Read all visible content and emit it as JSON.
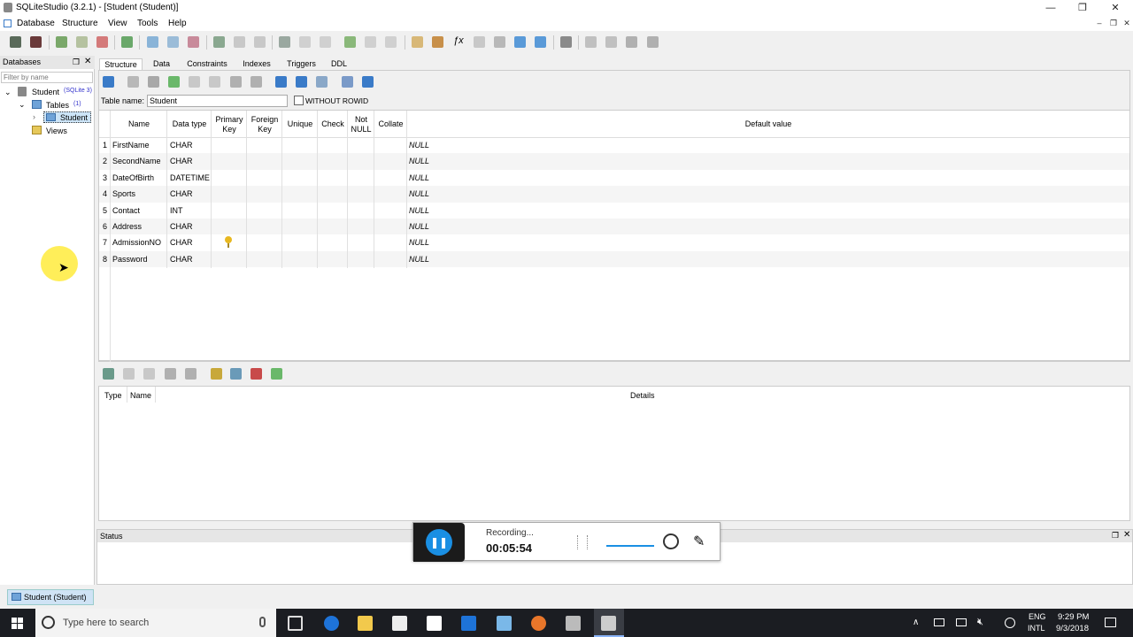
{
  "window": {
    "title": "SQLiteStudio (3.2.1) - [Student (Student)]",
    "controls": {
      "minimize": "—",
      "maximize": "❐",
      "close": "✕"
    }
  },
  "menu": {
    "items": [
      "Database",
      "Structure",
      "View",
      "Tools",
      "Help"
    ],
    "mdi_controls": {
      "minimize": "–",
      "restore": "❐",
      "close": "✕"
    }
  },
  "databases_panel": {
    "title": "Databases",
    "filter_placeholder": "Filter by name",
    "tree": {
      "db_name": "Student",
      "db_version": "(SQLite 3)",
      "tables_label": "Tables",
      "tables_count": "(1)",
      "table_name": "Student",
      "views_label": "Views"
    }
  },
  "tabs": [
    "Structure",
    "Data",
    "Constraints",
    "Indexes",
    "Triggers",
    "DDL"
  ],
  "structure": {
    "table_name_label": "Table name:",
    "table_name_value": "Student",
    "without_rowid_label": "WITHOUT ROWID",
    "columns": {
      "name": "Name",
      "data_type": "Data type",
      "primary_key_1": "Primary",
      "primary_key_2": "Key",
      "foreign_key_1": "Foreign",
      "foreign_key_2": "Key",
      "unique": "Unique",
      "check": "Check",
      "not_null_1": "Not",
      "not_null_2": "NULL",
      "collate": "Collate",
      "default_value": "Default value"
    },
    "rows": [
      {
        "num": "1",
        "name": "FirstName",
        "type": "CHAR",
        "pk": false,
        "default": "NULL"
      },
      {
        "num": "2",
        "name": "SecondName",
        "type": "CHAR",
        "pk": false,
        "default": "NULL"
      },
      {
        "num": "3",
        "name": "DateOfBirth",
        "type": "DATETIME",
        "pk": false,
        "default": "NULL"
      },
      {
        "num": "4",
        "name": "Sports",
        "type": "CHAR",
        "pk": false,
        "default": "NULL"
      },
      {
        "num": "5",
        "name": "Contact",
        "type": "INT",
        "pk": false,
        "default": "NULL"
      },
      {
        "num": "6",
        "name": "Address",
        "type": "CHAR",
        "pk": false,
        "default": "NULL"
      },
      {
        "num": "7",
        "name": "AdmissionNO",
        "type": "CHAR",
        "pk": true,
        "default": "NULL"
      },
      {
        "num": "8",
        "name": "Password",
        "type": "CHAR",
        "pk": false,
        "default": "NULL"
      }
    ]
  },
  "constraints": {
    "columns": {
      "type": "Type",
      "name": "Name",
      "details": "Details"
    }
  },
  "status_panel": {
    "title": "Status"
  },
  "recording": {
    "label": "Recording...",
    "time": "00:05:54"
  },
  "window_tab": {
    "label": "Student (Student)"
  },
  "taskbar": {
    "search_placeholder": "Type here to search",
    "lang_1": "ENG",
    "lang_2": "INTL",
    "time": "9:29 PM",
    "date": "9/3/2018"
  },
  "colors": {
    "accent": "#1a8fe3",
    "pk_key": "#e8b820",
    "taskbar": "#1b1d22"
  }
}
